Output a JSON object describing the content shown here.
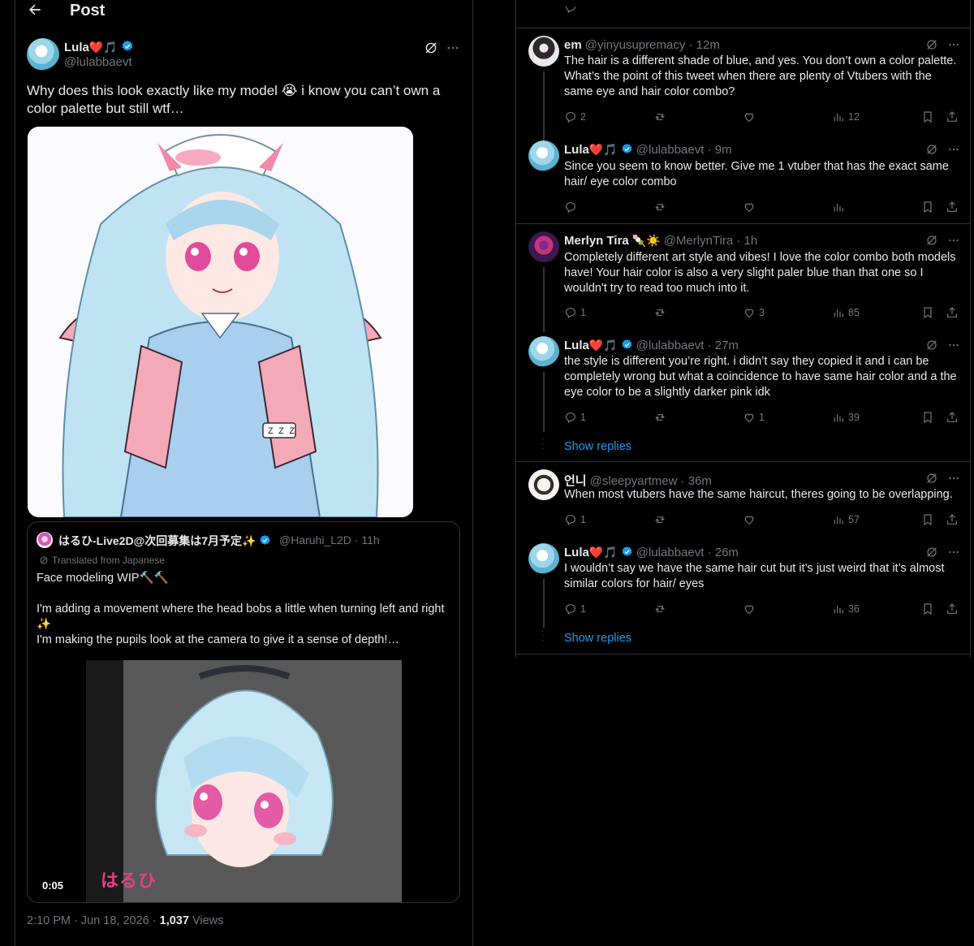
{
  "header": {
    "title": "Post"
  },
  "main_post": {
    "name": "Lula",
    "handle": "@lulabbaevt",
    "text": "Why does this look exactly like my model 😭 i know you can’t own a color palette but still wtf…",
    "timestamp": "2:10 PM · Jun 18, 2026 · ",
    "views_count": "1,037",
    "views_label": " Views"
  },
  "quote": {
    "name": "はるひ-Live2D@次回募集は7月予定✨",
    "handle": "@Haruhi_L2D · 11h",
    "translated": "Translated from Japanese",
    "text": "Face modeling WIP🔨🔨\n\nI'm adding a movement where the head bobs a little when turning left and right ✨\nI'm making the pupils look at the camera to give it a sense of depth!…",
    "video_time": "0:05",
    "logo_text": "はるひ"
  },
  "replies": [
    {
      "name": "em",
      "handle": "@yinyusupremacy · 12m",
      "text": "The hair is a different shade of blue, and yes. You don’t own a color palette. What’s the point of this tweet when there are plenty of Vtubers with the same eye and hair color combo?",
      "replies": "2",
      "likes": "",
      "views": "12"
    },
    {
      "name": "Lula",
      "handle": "@lulabbaevt · 9m",
      "text": "Since you seem to know better. Give me 1 vtuber that has the exact same hair/ eye color combo",
      "replies": "",
      "likes": "",
      "views": ""
    },
    {
      "name": "Merlyn Tira",
      "handle": "@MerlynTira · 1h",
      "text": "Completely different art style and vibes! I love the color combo both models have! Your hair color is also a very slight paler blue than that one so I wouldn't try to read too much into it.",
      "replies": "1",
      "likes": "3",
      "views": "85"
    },
    {
      "name": "Lula",
      "handle": "@lulabbaevt · 27m",
      "text": "the style is different you’re right. i didn’t say they copied it and i can be completely wrong but what a coincidence to have same hair color and a the eye color to be a slightly darker pink idk",
      "replies": "1",
      "likes": "1",
      "views": "39"
    },
    {
      "name": "언니",
      "handle": "@sleepyartmew · 36m",
      "text": "When most vtubers have the same haircut, theres going to be overlapping.",
      "replies": "1",
      "likes": "",
      "views": "57"
    },
    {
      "name": "Lula",
      "handle": "@lulabbaevt · 26m",
      "text": "I wouldn’t say we have the same hair cut but  it’s just weird that it’s almost similar colors for hair/ eyes",
      "replies": "1",
      "likes": "",
      "views": "36"
    }
  ],
  "show_replies_label": "Show replies",
  "emoji": {
    "heart": "❤️",
    "note": "🎵",
    "merlyn_extra": "🍡☀️"
  },
  "colors": {
    "accent": "#1d9bf0",
    "muted": "#71767b",
    "border": "#2f3336",
    "background": "#000000"
  }
}
